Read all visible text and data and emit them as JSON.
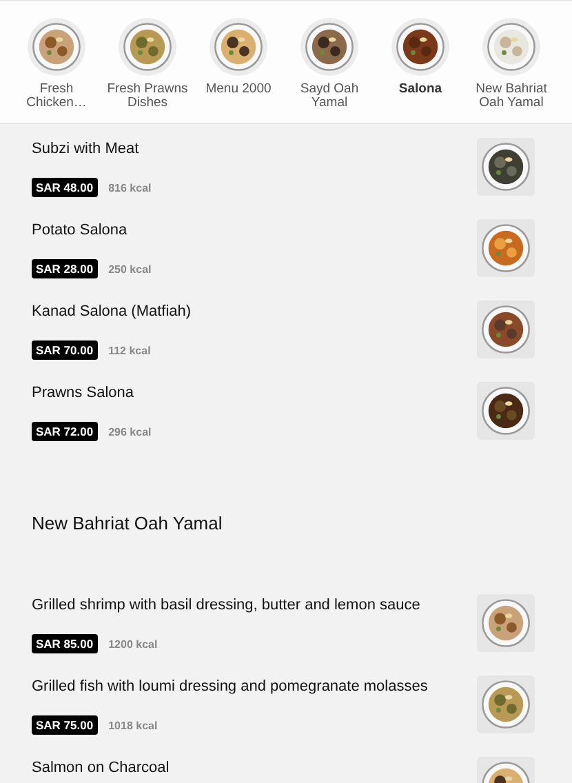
{
  "categories": [
    {
      "label": "Fresh Chicken…",
      "selected": false
    },
    {
      "label": "Fresh Prawns Dishes",
      "selected": false
    },
    {
      "label": "Menu 2000",
      "selected": false
    },
    {
      "label": "Sayd Oah Yamal",
      "selected": false
    },
    {
      "label": "Salona",
      "selected": true
    },
    {
      "label": "New Bahriat Oah Yamal",
      "selected": false
    }
  ],
  "sections": [
    {
      "items": [
        {
          "name": "Subzi with Meat",
          "price": "SAR 48.00",
          "kcal": "816 kcal"
        },
        {
          "name": "Potato Salona",
          "price": "SAR 28.00",
          "kcal": "250 kcal"
        },
        {
          "name": "Kanad Salona (Matfiah)",
          "price": "SAR 70.00",
          "kcal": "112 kcal"
        },
        {
          "name": "Prawns Salona",
          "price": "SAR 72.00",
          "kcal": "296 kcal"
        }
      ]
    },
    {
      "title": "New Bahriat Oah Yamal",
      "items": [
        {
          "name": "Grilled shrimp with basil dressing, butter and lemon sauce",
          "price": "SAR 85.00",
          "kcal": "1200 kcal"
        },
        {
          "name": "Grilled fish with loumi dressing and pomegranate molasses",
          "price": "SAR 75.00",
          "kcal": "1018 kcal"
        },
        {
          "name": "Salmon on Charcoal"
        }
      ]
    }
  ]
}
